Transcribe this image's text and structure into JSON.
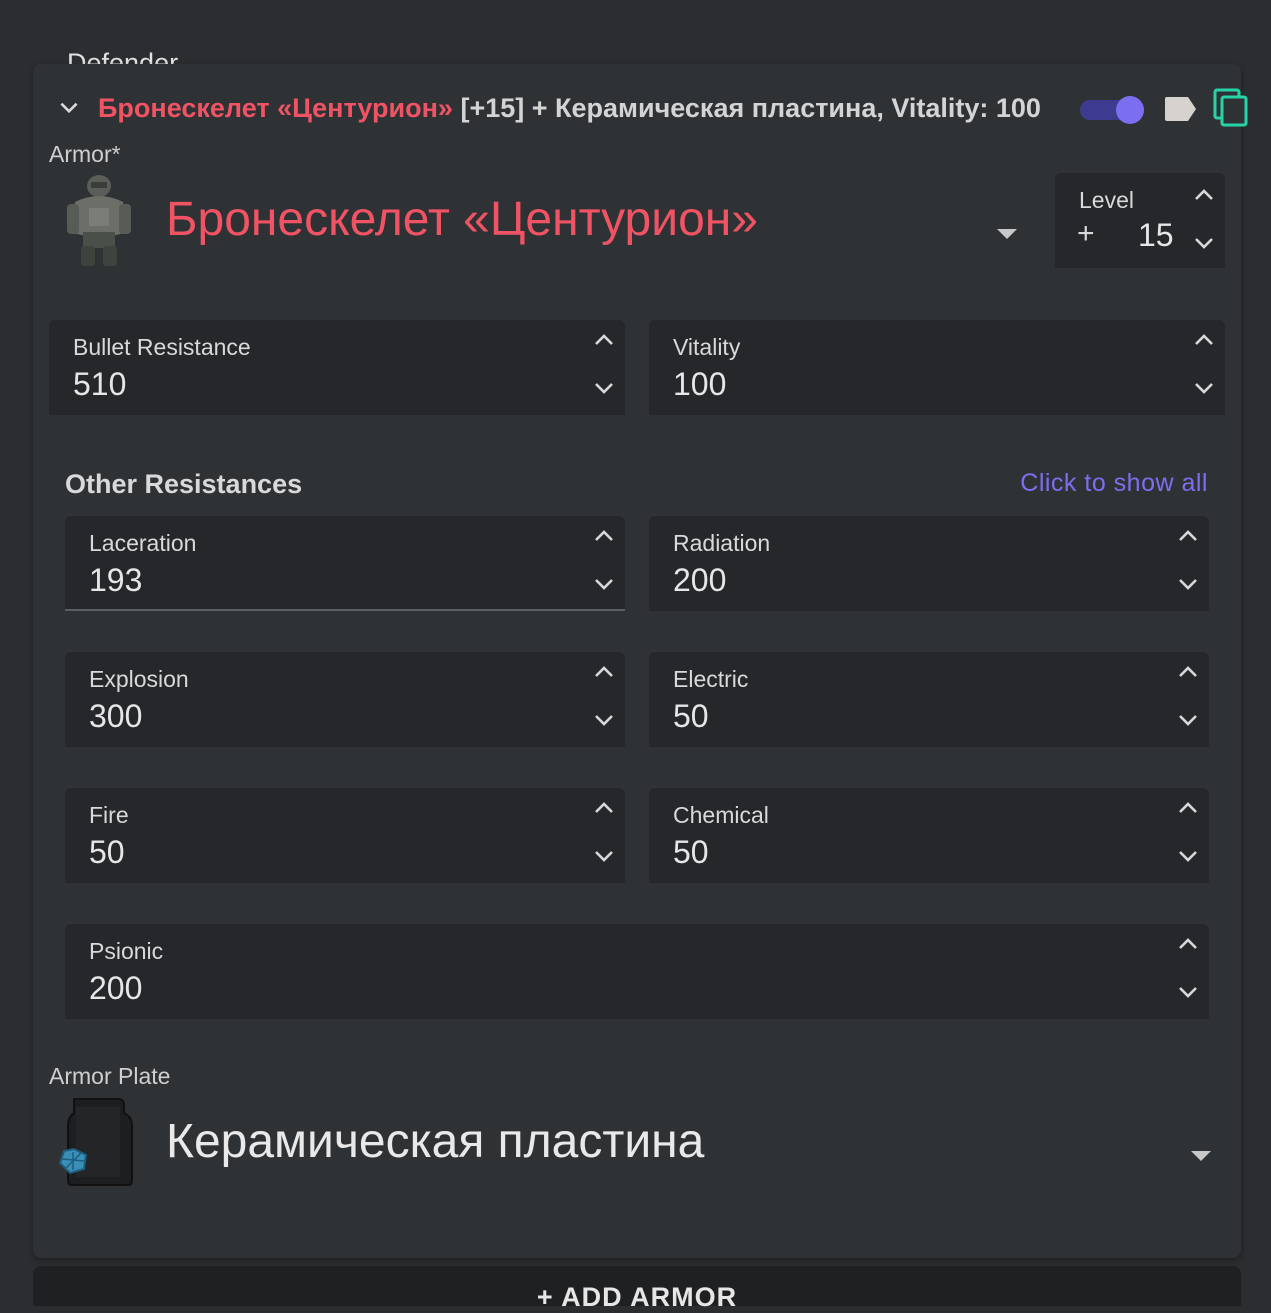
{
  "section": {
    "legend": "Defender"
  },
  "header": {
    "armor_name": "Бронескелет «Центурион»",
    "summary": " [+15] + Керамическая пластина, Vitality: 100",
    "enabled": true
  },
  "armor": {
    "label": "Armor*",
    "name": "Бронескелет «Центурион»",
    "level_label": "Level",
    "level_prefix": "+",
    "level_value": "15"
  },
  "main_stats": [
    {
      "label": "Bullet Resistance",
      "value": "510"
    },
    {
      "label": "Vitality",
      "value": "100"
    }
  ],
  "other_resistances": {
    "title": "Other Resistances",
    "show_all": "Click to show all",
    "items": [
      {
        "label": "Laceration",
        "value": "193"
      },
      {
        "label": "Radiation",
        "value": "200"
      },
      {
        "label": "Explosion",
        "value": "300"
      },
      {
        "label": "Electric",
        "value": "50"
      },
      {
        "label": "Fire",
        "value": "50"
      },
      {
        "label": "Chemical",
        "value": "50"
      },
      {
        "label": "Psionic",
        "value": "200"
      }
    ]
  },
  "plate": {
    "label": "Armor Plate",
    "name": "Керамическая пластина"
  },
  "add_button": {
    "label": "+ ADD ARMOR"
  },
  "colors": {
    "accent": "#7b6ff0",
    "armor_name": "#f05364",
    "copy_icon": "#27d3a6"
  }
}
